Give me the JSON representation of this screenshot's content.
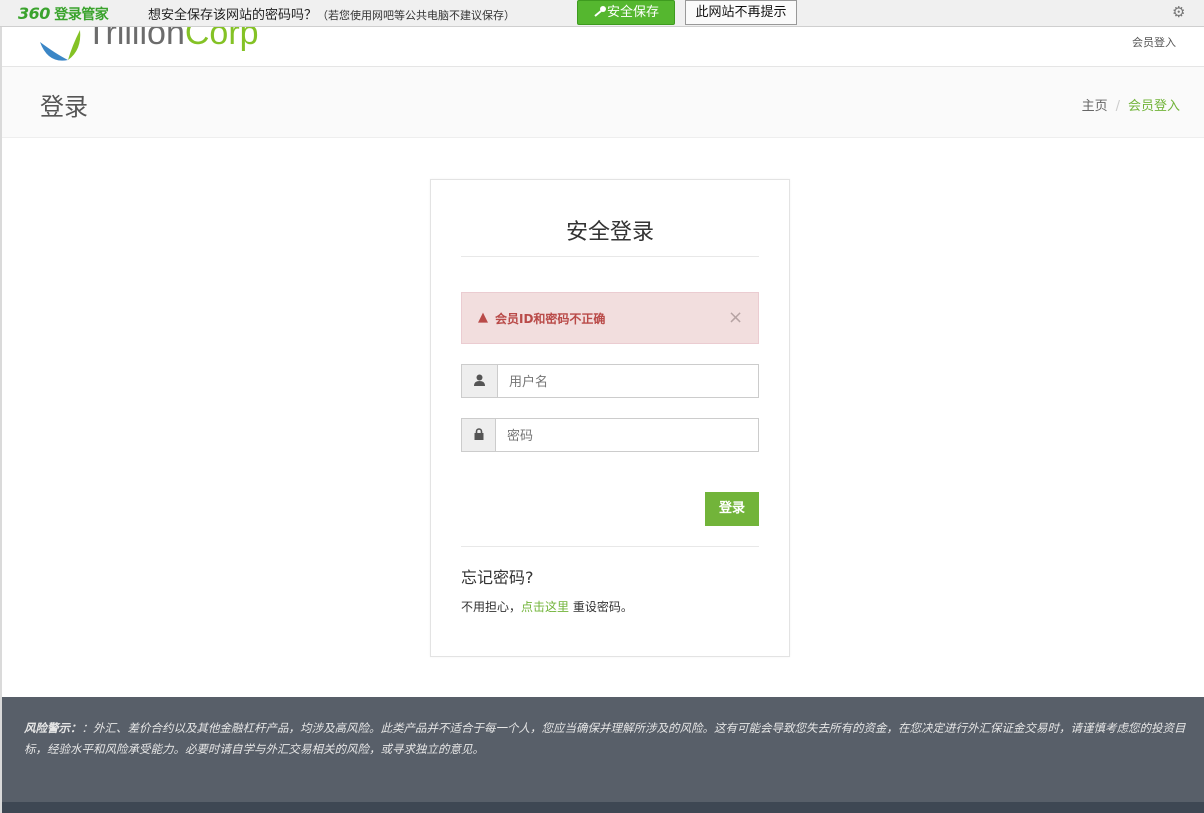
{
  "password_bar": {
    "logo_num": "360",
    "logo_text": "登录管家",
    "question": "想安全保存该网站的密码吗？",
    "hint": "（若您使用网吧等公共电脑不建议保存）",
    "save_label": "安全保存",
    "never_label": "此网站不再提示",
    "settings_icon": "gear-icon"
  },
  "header": {
    "brand_part1": "Trillion",
    "brand_part2": "Corp",
    "member_link": "会员登入"
  },
  "title_bar": {
    "title": "登录",
    "breadcrumb": [
      "主页",
      "会员登入"
    ],
    "separator": "/"
  },
  "login": {
    "title": "安全登录",
    "alert_message": "会员ID和密码不正确",
    "alert_close": "×",
    "username_placeholder": "用户名",
    "password_placeholder": "密码",
    "submit_label": "登录",
    "forgot_title": "忘记密码?",
    "help_prefix": "不用担心，",
    "help_link": "点击这里",
    "help_suffix": "重设密码。"
  },
  "footer": {
    "label": "风险警示：",
    "text": "：外汇、差价合约以及其他金融杠杆产品，均涉及高风险。此类产品并不适合于每一个人，您应当确保并理解所涉及的风险。这有可能会导致您失去所有的资金，在您决定进行外汇保证金交易时，请谨慎考虑您的投资目标，经验水平和风险承受能力。必要时请自学与外汇交易相关的风险，或寻求独立的意见。"
  },
  "colors": {
    "accent": "#72b43a",
    "alert_bg": "#f2dede",
    "alert_text": "#b94a48",
    "footer_bg": "#585f69"
  }
}
